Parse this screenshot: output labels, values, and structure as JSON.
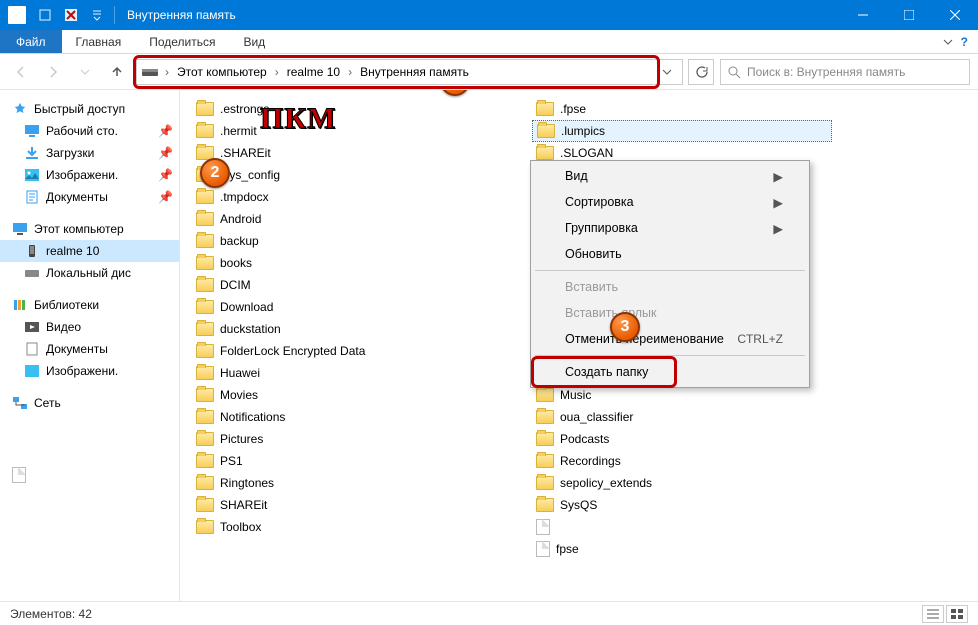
{
  "window": {
    "title": "Внутренняя память"
  },
  "ribbon": {
    "file": "Файл",
    "tabs": [
      "Главная",
      "Поделиться",
      "Вид"
    ]
  },
  "breadcrumb": {
    "items": [
      "Этот компьютер",
      "realme 10",
      "Внутренняя память"
    ]
  },
  "search": {
    "placeholder": "Поиск в: Внутренняя память"
  },
  "sidebar": {
    "quick": {
      "label": "Быстрый доступ",
      "items": [
        {
          "label": "Рабочий сто.",
          "icon": "desktop"
        },
        {
          "label": "Загрузки",
          "icon": "downloads"
        },
        {
          "label": "Изображени.",
          "icon": "pictures"
        },
        {
          "label": "Документы",
          "icon": "documents"
        }
      ]
    },
    "pc": {
      "label": "Этот компьютер",
      "items": [
        {
          "label": "realme 10",
          "selected": true
        },
        {
          "label": "Локальный дис"
        }
      ]
    },
    "libs": {
      "label": "Библиотеки",
      "items": [
        {
          "label": "Видео"
        },
        {
          "label": "Документы"
        },
        {
          "label": "Изображени."
        }
      ]
    },
    "network": {
      "label": "Сеть"
    }
  },
  "files": {
    "col1": [
      ".estrongs",
      ".hermit",
      ".SHAREit",
      ".sys_config",
      ".tmpdocx",
      "Android",
      "backup",
      "books",
      "DCIM",
      "Download",
      "duckstation",
      "FolderLock Encrypted Data",
      "Huawei",
      "Movies",
      "Notifications",
      "Pictures",
      "PS1",
      "Ringtones",
      "SHAREit",
      "Toolbox"
    ],
    "col2": [
      ".fpse",
      ".lumpics",
      ".SLOGAN",
      "",
      "",
      "",
      "",
      "",
      "",
      "",
      "",
      "",
      "",
      "Music",
      "oua_classifier",
      "Podcasts",
      "Recordings",
      "sepolicy_extends",
      "SysQS"
    ],
    "col2_files": [
      "",
      "fpse"
    ]
  },
  "context_menu": {
    "view": "Вид",
    "sort": "Сортировка",
    "group": "Группировка",
    "refresh": "Обновить",
    "paste": "Вставить",
    "paste_shortcut": "Вставить ярлык",
    "undo": "Отменить переименование",
    "undo_short": "CTRL+Z",
    "new_folder": "Создать папку"
  },
  "statusbar": {
    "count_label": "Элементов: 42"
  },
  "annotations": {
    "pkm": "ПКМ"
  },
  "colors": {
    "accent": "#0078d7",
    "highlight": "#c00000"
  }
}
